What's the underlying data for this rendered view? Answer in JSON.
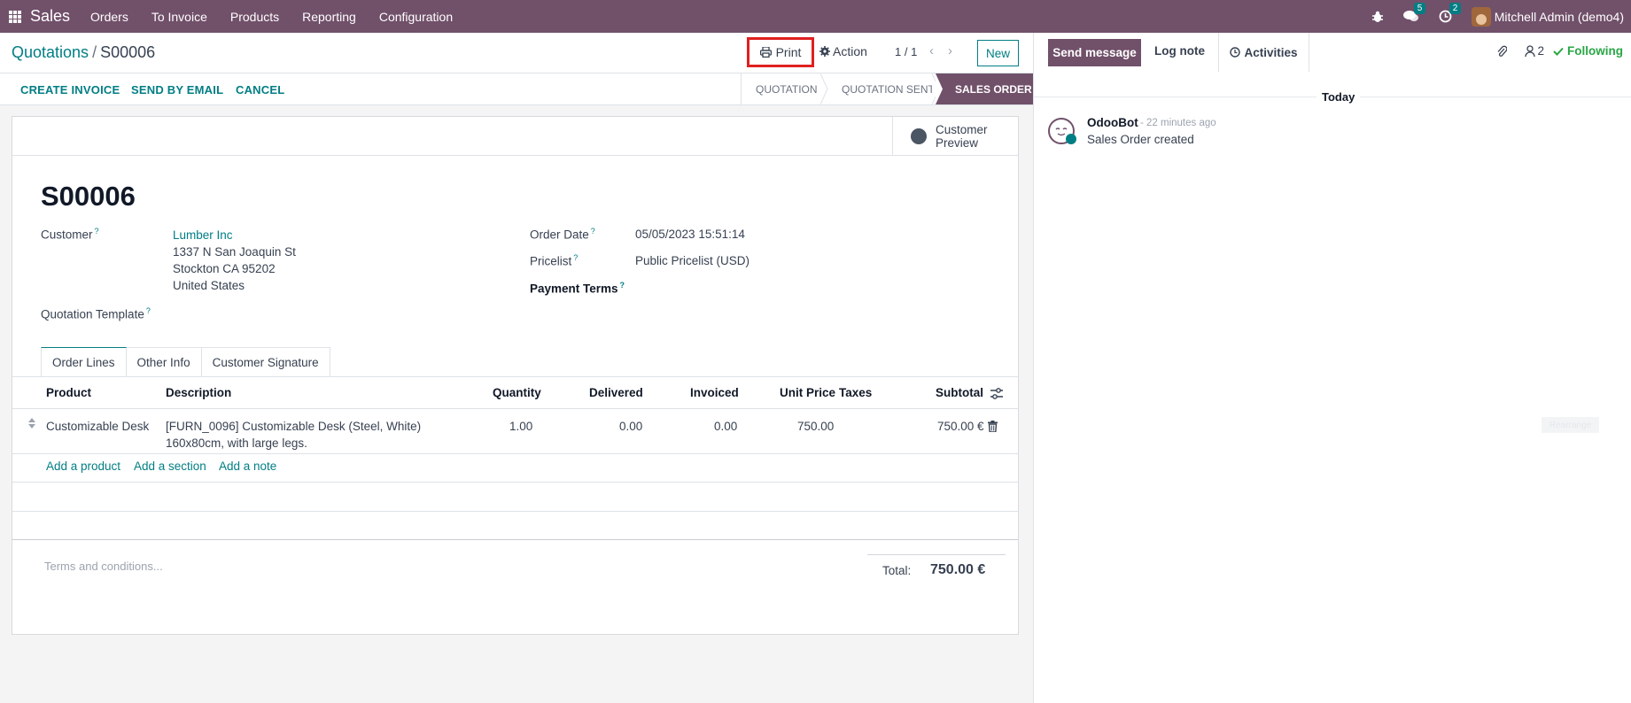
{
  "topbar": {
    "app_name": "Sales",
    "menu": [
      "Orders",
      "To Invoice",
      "Products",
      "Reporting",
      "Configuration"
    ],
    "messages_count": "5",
    "activities_count": "2",
    "user": "Mitchell Admin (demo4)"
  },
  "control": {
    "breadcrumb_parent": "Quotations",
    "breadcrumb_sep": "/",
    "breadcrumb_current": "S00006",
    "print_label": "Print",
    "action_label": "Action",
    "pager": "1 / 1",
    "new_label": "New"
  },
  "status": {
    "buttons": [
      "CREATE INVOICE",
      "SEND BY EMAIL",
      "CANCEL"
    ],
    "stages": [
      "QUOTATION",
      "QUOTATION SENT",
      "SALES ORDER"
    ],
    "active_stage": "SALES ORDER"
  },
  "form": {
    "preview_label_1": "Customer",
    "preview_label_2": "Preview",
    "name": "S00006",
    "customer_label": "Customer",
    "customer_name": "Lumber Inc",
    "address_1": "1337 N San Joaquin St",
    "address_2": "Stockton CA 95202",
    "address_3": "United States",
    "template_label": "Quotation Template",
    "order_date_label": "Order Date",
    "order_date": "05/05/2023 15:51:14",
    "pricelist_label": "Pricelist",
    "pricelist": "Public Pricelist (USD)",
    "payment_terms_label": "Payment Terms",
    "help_mark": "?"
  },
  "tabs": [
    "Order Lines",
    "Other Info",
    "Customer Signature"
  ],
  "table": {
    "headers": {
      "product": "Product",
      "description": "Description",
      "quantity": "Quantity",
      "delivered": "Delivered",
      "invoiced": "Invoiced",
      "unit_price": "Unit Price",
      "taxes": "Taxes",
      "subtotal": "Subtotal"
    },
    "rows": [
      {
        "product": "Customizable Desk",
        "description_1": "[FURN_0096] Customizable Desk (Steel, White)",
        "description_2": "160x80cm, with large legs.",
        "quantity": "1.00",
        "delivered": "0.00",
        "invoiced": "0.00",
        "unit_price": "750.00",
        "subtotal": "750.00 €"
      }
    ],
    "add_product": "Add a product",
    "add_section": "Add a section",
    "add_note": "Add a note"
  },
  "footer": {
    "terms_placeholder": "Terms and conditions...",
    "total_label": "Total:",
    "total_value": "750.00 €"
  },
  "chatter": {
    "send_message": "Send message",
    "log_note": "Log note",
    "activities": "Activities",
    "followers_count": "2",
    "following": "Following",
    "date_separator": "Today",
    "messages": [
      {
        "author": "OdooBot",
        "time": "- 22 minutes ago",
        "body": "Sales Order created"
      }
    ],
    "faint_button": "Rearrange"
  },
  "colors": {
    "brand": "#71506a",
    "accent": "#017e84",
    "highlight": "#e02020",
    "following": "#28a745"
  }
}
